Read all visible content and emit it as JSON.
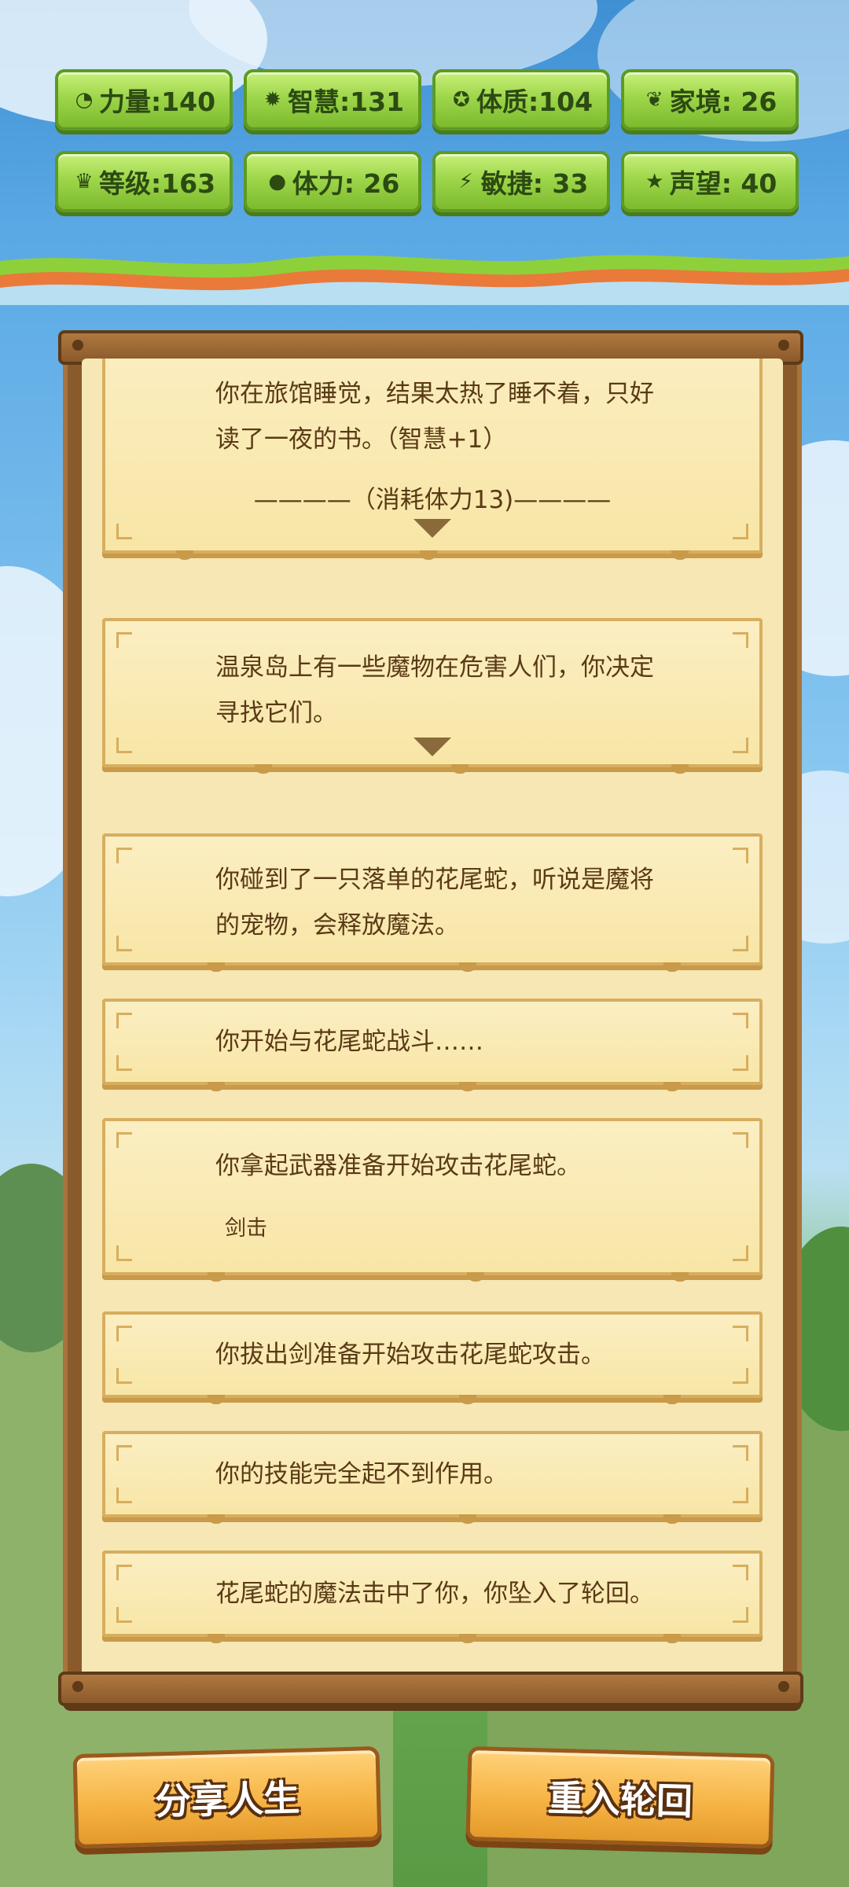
{
  "stats": [
    {
      "icon": "strength-icon",
      "glyph": "◔",
      "label": "力量:140"
    },
    {
      "icon": "wisdom-icon",
      "glyph": "✹",
      "label": "智慧:131"
    },
    {
      "icon": "constitution-icon",
      "glyph": "✪",
      "label": "体质:104"
    },
    {
      "icon": "family-icon",
      "glyph": "❦",
      "label": "家境: 26"
    },
    {
      "icon": "crown-icon",
      "glyph": "♛",
      "label": "等级:163"
    },
    {
      "icon": "stamina-icon",
      "glyph": "●",
      "label": "体力: 26"
    },
    {
      "icon": "agility-icon",
      "glyph": "⚡",
      "label": "敏捷: 33"
    },
    {
      "icon": "fame-icon",
      "glyph": "★",
      "label": "声望: 40"
    }
  ],
  "log": {
    "entry1": {
      "line1": "你在旅馆睡觉，结果太热了睡不着，只好",
      "line2": "读了一夜的书。（智慧+1）",
      "line3": "————（消耗体力13)————"
    },
    "entry2": {
      "line1": "温泉岛上有一些魔物在危害人们，你决定",
      "line2": "寻找它们。"
    },
    "entry3": {
      "line1": "你碰到了一只落单的花尾蛇，听说是魔将",
      "line2": "的宠物，会释放魔法。"
    },
    "entry4": {
      "line1": "你开始与花尾蛇战斗……"
    },
    "entry5": {
      "line1": "你拿起武器准备开始攻击花尾蛇。",
      "skill": "剑击"
    },
    "entry6": {
      "line1": "你拔出剑准备开始攻击花尾蛇攻击。"
    },
    "entry7": {
      "line1": "你的技能完全起不到作用。"
    },
    "entry8": {
      "line1": "花尾蛇的魔法击中了你，你坠入了轮回。"
    }
  },
  "buttons": {
    "share": "分享人生",
    "rebirth": "重入轮回"
  }
}
